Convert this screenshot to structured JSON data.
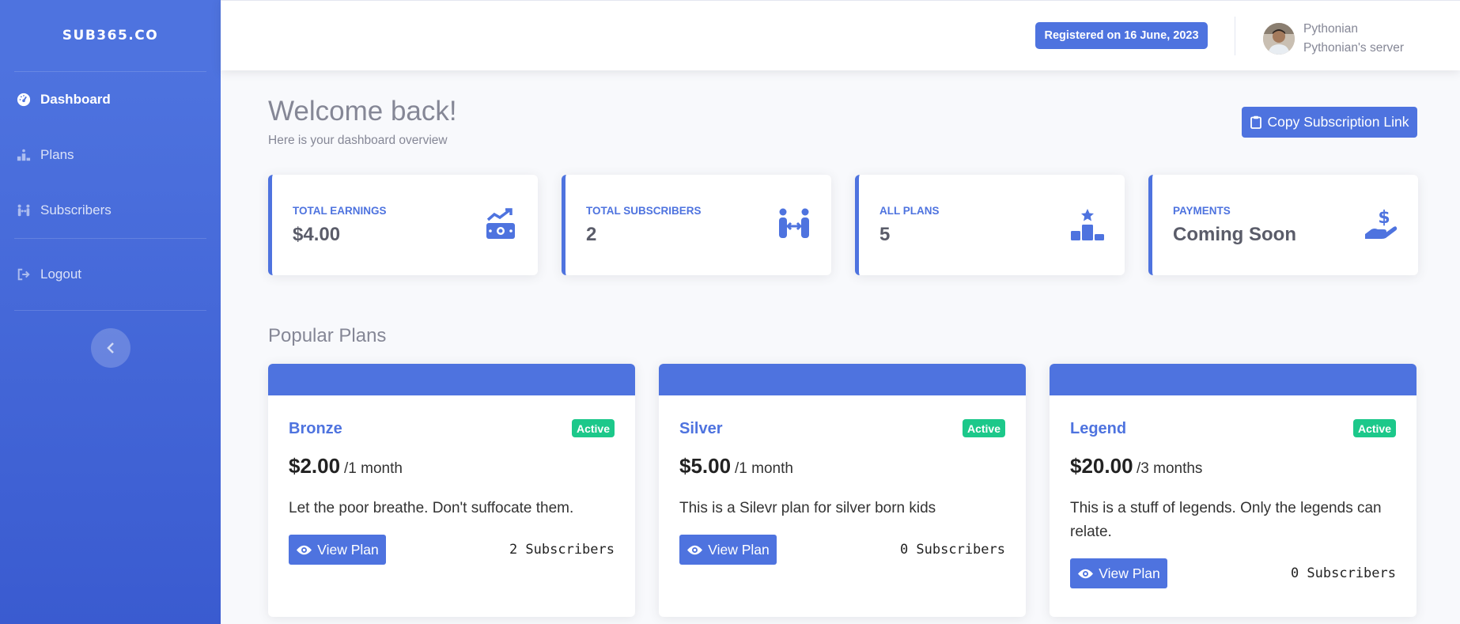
{
  "sidebar": {
    "brand": "SUB365.CO",
    "items": [
      {
        "label": "Dashboard",
        "icon": "gauge-icon"
      },
      {
        "label": "Plans",
        "icon": "podium-icon"
      },
      {
        "label": "Subscribers",
        "icon": "people-arrows-icon"
      },
      {
        "label": "Logout",
        "icon": "sign-out-icon"
      }
    ],
    "toggle_icon": "chevron-left-icon"
  },
  "topbar": {
    "registered": "Registered on 16 June, 2023",
    "user_name": "Pythonian",
    "server_name": "Pythonian's server"
  },
  "main": {
    "welcome": "Welcome back!",
    "subtitle": "Here is your dashboard overview",
    "copy_button": "Copy Subscription Link",
    "stats": [
      {
        "label": "Total Earnings",
        "value": "$4.00",
        "icon": "money-chart-icon"
      },
      {
        "label": "Total Subscribers",
        "value": "2",
        "icon": "people-arrows-icon"
      },
      {
        "label": "All Plans",
        "value": "5",
        "icon": "ranking-star-icon"
      },
      {
        "label": "Payments",
        "value": "Coming Soon",
        "icon": "hand-holding-dollar-icon"
      }
    ],
    "popular_title": "Popular Plans",
    "plans": [
      {
        "name": "Bronze",
        "status": "Active",
        "price": "$2.00",
        "period": "/1 month",
        "description": "Let the poor breathe. Don't suffocate them.",
        "button": "View Plan",
        "subscribers": "2 Subscribers"
      },
      {
        "name": "Silver",
        "status": "Active",
        "price": "$5.00",
        "period": "/1 month",
        "description": "This is a Silevr plan for silver born kids",
        "button": "View Plan",
        "subscribers": "0 Subscribers"
      },
      {
        "name": "Legend",
        "status": "Active",
        "price": "$20.00",
        "period": "/3 months",
        "description": "This is a stuff of legends. Only the legends can relate.",
        "button": "View Plan",
        "subscribers": "0 Subscribers"
      }
    ]
  },
  "colors": {
    "primary": "#4e73df",
    "success": "#1cc88a",
    "muted": "#858796"
  }
}
